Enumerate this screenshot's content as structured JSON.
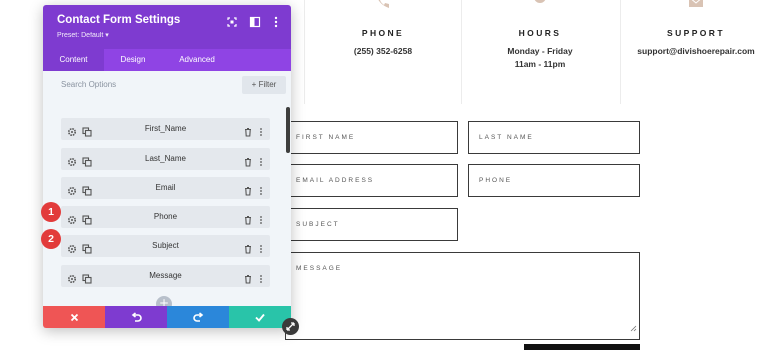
{
  "info": {
    "phone": {
      "title": "PHONE",
      "text": "(255) 352-6258",
      "icon": "phone-icon"
    },
    "hours": {
      "title": "HOURS",
      "line1": "Monday - Friday",
      "line2": "11am - 11pm",
      "icon": "clock-icon"
    },
    "support": {
      "title": "SUPPORT",
      "text": "support@divishoerepair.com",
      "icon": "envelope-icon"
    }
  },
  "form": {
    "first_name": "FIRST NAME",
    "last_name": "LAST NAME",
    "email": "EMAIL ADDRESS",
    "phone": "PHONE",
    "subject": "SUBJECT",
    "message": "MESSAGE"
  },
  "modal": {
    "title": "Contact Form Settings",
    "preset": "Preset: Default ▾",
    "tabs": [
      {
        "label": "Content",
        "active": true
      },
      {
        "label": "Design",
        "active": false
      },
      {
        "label": "Advanced",
        "active": false
      }
    ],
    "search_placeholder": "Search Options",
    "filter_label": "Filter",
    "items": [
      {
        "label": "First_Name"
      },
      {
        "label": "Last_Name"
      },
      {
        "label": "Email"
      },
      {
        "label": "Phone"
      },
      {
        "label": "Subject"
      },
      {
        "label": "Message"
      }
    ],
    "add_symbol": "+"
  },
  "badges": [
    "1",
    "2"
  ],
  "colors": {
    "primary": "#7e3bd0",
    "tab_bar": "#8f44e4",
    "cancel": "#ef5555",
    "undo": "#7e3bd0",
    "redo": "#2b87da",
    "save": "#29c4a9",
    "badge": "#e23b3b",
    "info_icon": "#d9c3b4"
  }
}
